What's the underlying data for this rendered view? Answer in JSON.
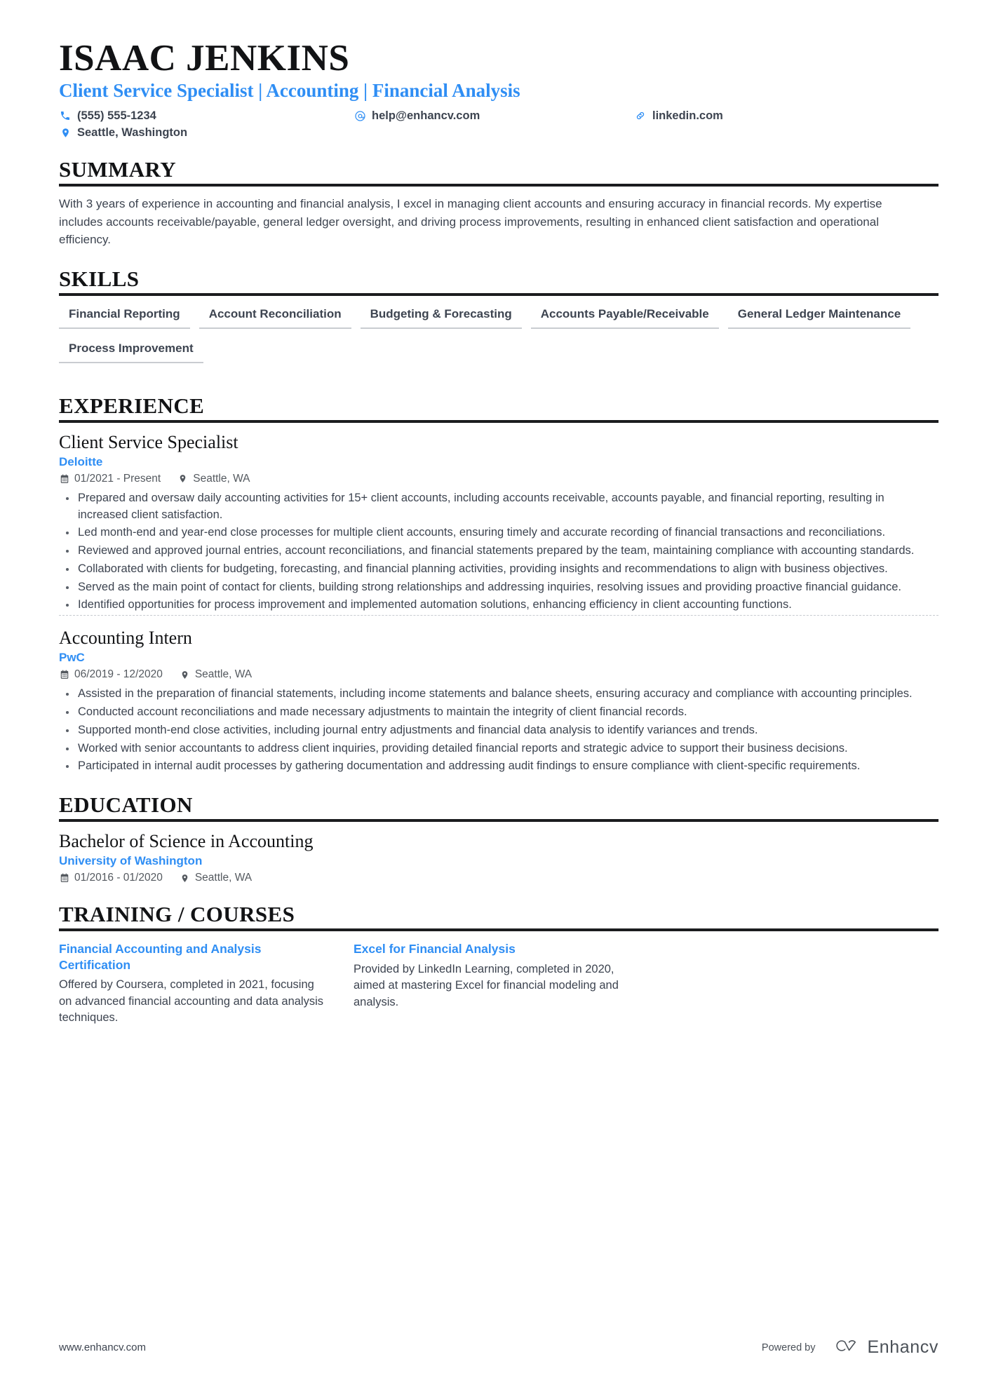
{
  "colors": {
    "accent": "#2f8ef4",
    "text": "#3d4450",
    "heading": "#121315",
    "rule": "#1b1c1e",
    "skill_underline": "#c9ccd1"
  },
  "header": {
    "name": "ISAAC JENKINS",
    "headline": "Client Service Specialist | Accounting | Financial Analysis",
    "contacts": [
      {
        "icon": "phone-icon",
        "label": "(555) 555-1234"
      },
      {
        "icon": "email-icon",
        "label": "help@enhancv.com"
      },
      {
        "icon": "link-icon",
        "label": "linkedin.com"
      },
      {
        "icon": "location-icon",
        "label": "Seattle, Washington"
      }
    ]
  },
  "sections": {
    "summary": {
      "title": "SUMMARY",
      "text": "With 3 years of experience in accounting and financial analysis, I excel in managing client accounts and ensuring accuracy in financial records. My expertise includes accounts receivable/payable, general ledger oversight, and driving process improvements, resulting in enhanced client satisfaction and operational efficiency."
    },
    "skills": {
      "title": "SKILLS",
      "items": [
        "Financial Reporting",
        "Account Reconciliation",
        "Budgeting & Forecasting",
        "Accounts Payable/Receivable",
        "General Ledger Maintenance",
        "Process Improvement"
      ]
    },
    "experience": {
      "title": "EXPERIENCE",
      "entries": [
        {
          "title": "Client Service Specialist",
          "organization": "Deloitte",
          "dates": "01/2021 - Present",
          "location": "Seattle, WA",
          "bullets": [
            "Prepared and oversaw daily accounting activities for 15+ client accounts, including accounts receivable, accounts payable, and financial reporting, resulting in increased client satisfaction.",
            "Led month-end and year-end close processes for multiple client accounts, ensuring timely and accurate recording of financial transactions and reconciliations.",
            "Reviewed and approved journal entries, account reconciliations, and financial statements prepared by the team, maintaining compliance with accounting standards.",
            "Collaborated with clients for budgeting, forecasting, and financial planning activities, providing insights and recommendations to align with business objectives.",
            "Served as the main point of contact for clients, building strong relationships and addressing inquiries, resolving issues and providing proactive financial guidance.",
            "Identified opportunities for process improvement and implemented automation solutions, enhancing efficiency in client accounting functions."
          ]
        },
        {
          "title": "Accounting Intern",
          "organization": "PwC",
          "dates": "06/2019 - 12/2020",
          "location": "Seattle, WA",
          "bullets": [
            "Assisted in the preparation of financial statements, including income statements and balance sheets, ensuring accuracy and compliance with accounting principles.",
            "Conducted account reconciliations and made necessary adjustments to maintain the integrity of client financial records.",
            "Supported month-end close activities, including journal entry adjustments and financial data analysis to identify variances and trends.",
            "Worked with senior accountants to address client inquiries, providing detailed financial reports and strategic advice to support their business decisions.",
            "Participated in internal audit processes by gathering documentation and addressing audit findings to ensure compliance with client-specific requirements."
          ]
        }
      ]
    },
    "education": {
      "title": "EDUCATION",
      "entries": [
        {
          "title": "Bachelor of Science in Accounting",
          "organization": "University of Washington",
          "dates": "01/2016 - 01/2020",
          "location": "Seattle, WA"
        }
      ]
    },
    "training": {
      "title": "TRAINING / COURSES",
      "courses": [
        {
          "title": "Financial Accounting and Analysis Certification",
          "description": "Offered by Coursera, completed in 2021, focusing on advanced financial accounting and data analysis techniques."
        },
        {
          "title": "Excel for Financial Analysis",
          "description": "Provided by LinkedIn Learning, completed in 2020, aimed at mastering Excel for financial modeling and analysis."
        }
      ]
    }
  },
  "footer": {
    "url": "www.enhancv.com",
    "powered_by": "Powered by",
    "brand": "Enhancv"
  }
}
